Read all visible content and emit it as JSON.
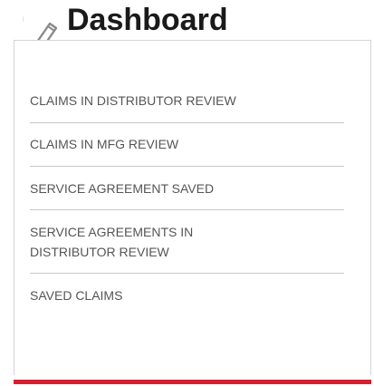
{
  "header": {
    "title": "Dashboard",
    "icon": "pencil-icon",
    "accent_color": "#d6202f"
  },
  "menu": {
    "items": [
      {
        "label": "CLAIMS IN DISTRIBUTOR REVIEW"
      },
      {
        "label": "CLAIMS IN MFG REVIEW"
      },
      {
        "label": "SERVICE AGREEMENT SAVED"
      },
      {
        "label": "SERVICE AGREEMENTS IN DISTRIBUTOR REVIEW"
      },
      {
        "label": "SAVED CLAIMS"
      }
    ]
  }
}
